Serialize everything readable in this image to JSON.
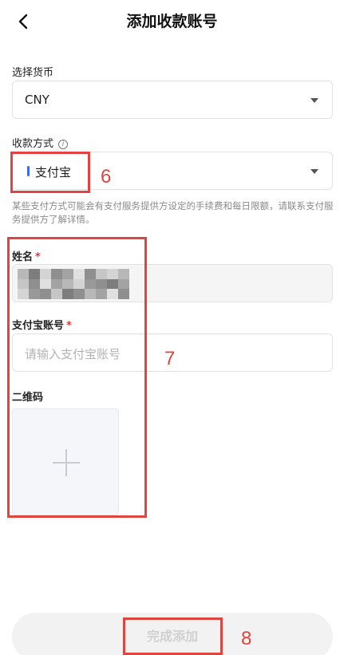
{
  "header": {
    "title": "添加收款账号",
    "back_icon": "chevron-left-icon"
  },
  "currency": {
    "label": "选择货币",
    "value": "CNY"
  },
  "method": {
    "label": "收款方式",
    "value": "支付宝",
    "note": "某些支付方式可能会有支付服务提供方设定的手续费和每日限额，请联系支付服务提供方了解详情。",
    "accent": "#3b6df0"
  },
  "name_field": {
    "label": "姓名",
    "required": "*"
  },
  "account_field": {
    "label": "支付宝账号",
    "required": "*",
    "placeholder": "请输入支付宝账号"
  },
  "qrcode": {
    "label": "二维码"
  },
  "submit": {
    "label": "完成添加"
  },
  "annotations": [
    "6",
    "7",
    "8"
  ],
  "colors": {
    "annotation": "#e0443e",
    "required": "#e23b3b"
  }
}
